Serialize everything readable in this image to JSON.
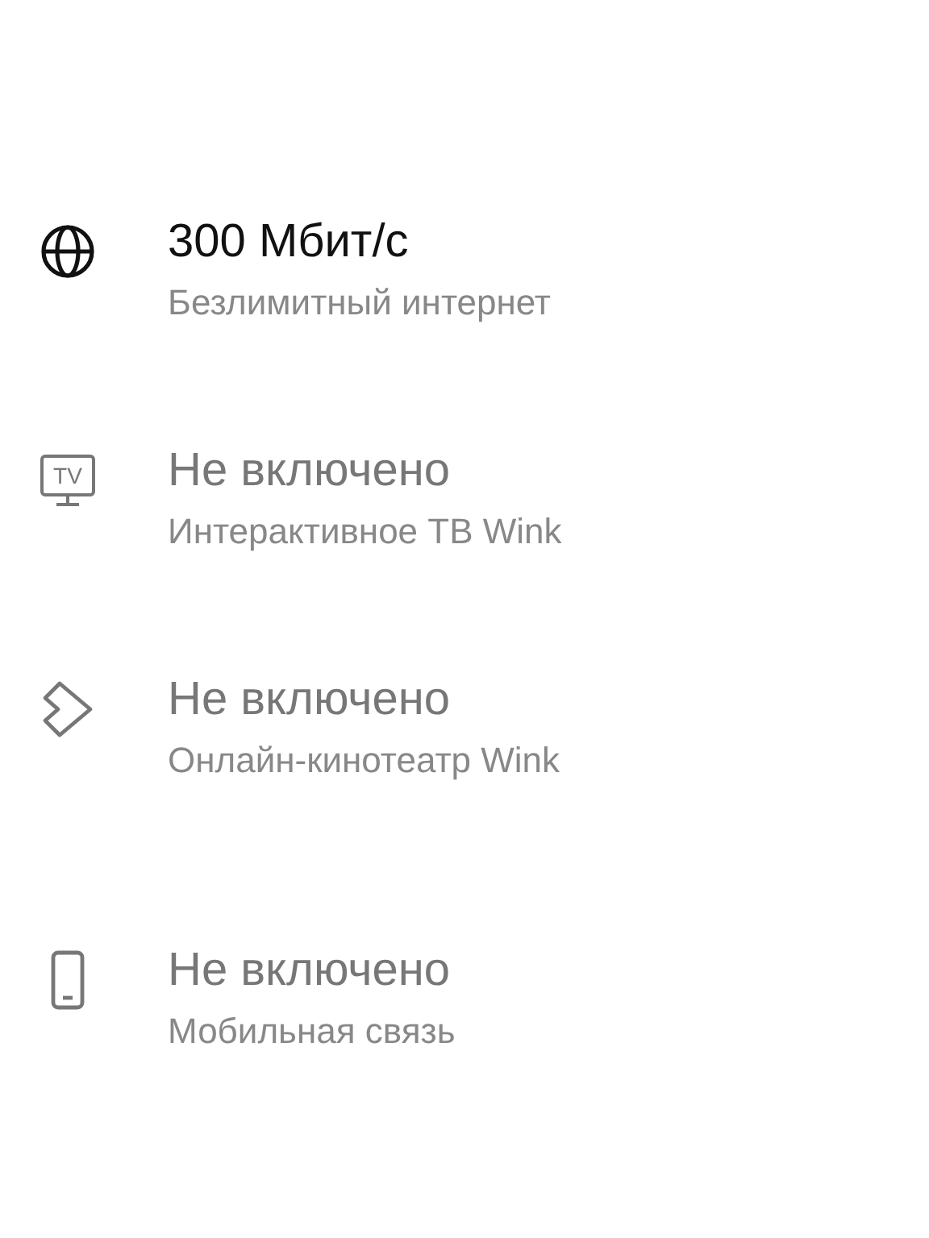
{
  "services": [
    {
      "kind": "internet",
      "title": "300 Мбит/с",
      "subtitle": "Безлимитный интернет",
      "enabled": true
    },
    {
      "kind": "tv",
      "icon_label": "TV",
      "title": "Не включено",
      "subtitle": "Интерактивное ТВ Wink",
      "enabled": false
    },
    {
      "kind": "cinema",
      "title": "Не включено",
      "subtitle": "Онлайн-кинотеатр Wink",
      "enabled": false
    },
    {
      "kind": "mobile",
      "title": "Не включено",
      "subtitle": "Мобильная связь",
      "enabled": false
    }
  ]
}
